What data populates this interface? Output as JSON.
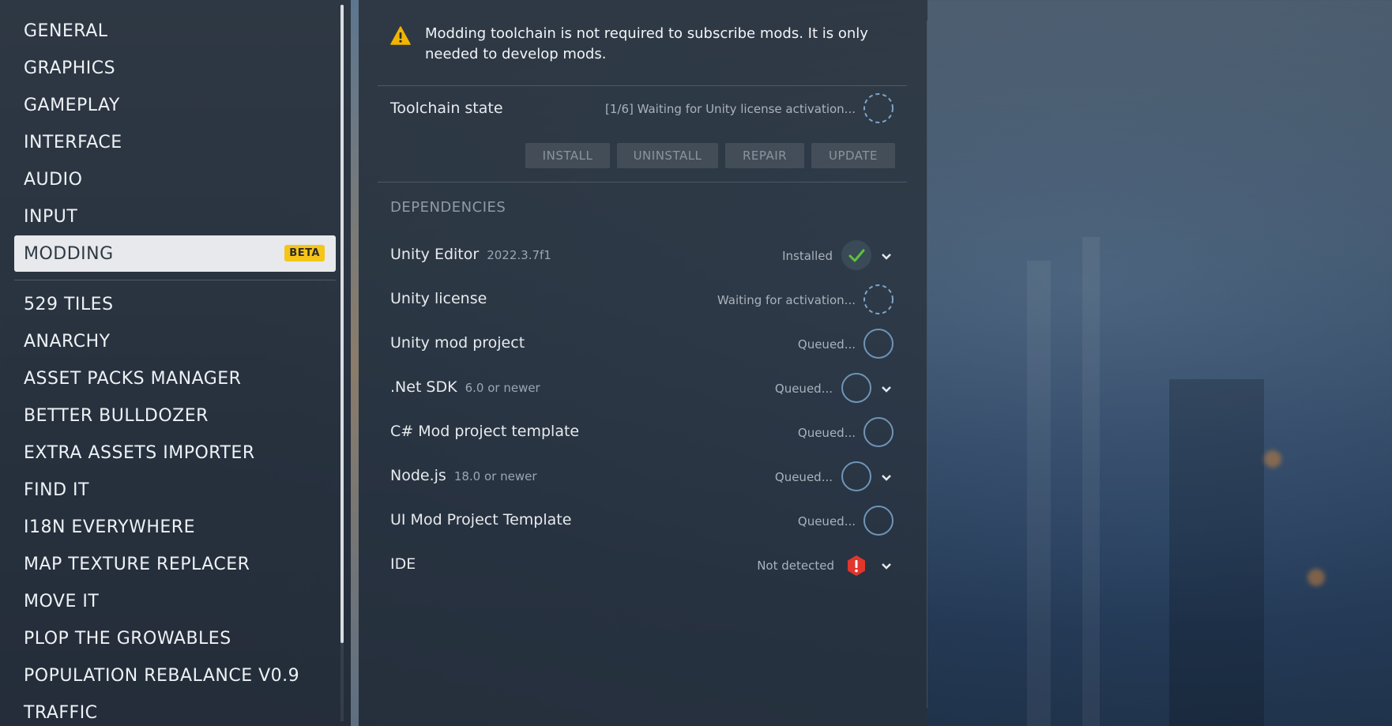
{
  "sidebar": {
    "items": [
      {
        "label": "GENERAL"
      },
      {
        "label": "GRAPHICS"
      },
      {
        "label": "GAMEPLAY"
      },
      {
        "label": "INTERFACE"
      },
      {
        "label": "AUDIO"
      },
      {
        "label": "INPUT"
      },
      {
        "label": "MODDING",
        "badge": "BETA",
        "active": true
      },
      {
        "label": "529 TILES"
      },
      {
        "label": "ANARCHY"
      },
      {
        "label": "ASSET PACKS MANAGER"
      },
      {
        "label": "BETTER BULLDOZER"
      },
      {
        "label": "EXTRA ASSETS IMPORTER"
      },
      {
        "label": "FIND IT"
      },
      {
        "label": "I18N EVERYWHERE"
      },
      {
        "label": "MAP TEXTURE REPLACER"
      },
      {
        "label": "MOVE IT"
      },
      {
        "label": "PLOP THE GROWABLES"
      },
      {
        "label": "POPULATION REBALANCE V0.9"
      },
      {
        "label": "TRAFFIC"
      }
    ]
  },
  "notice": {
    "text": "Modding toolchain is not required to subscribe mods. It is only needed to develop mods."
  },
  "toolchain": {
    "label": "Toolchain state",
    "status": "[1/6] Waiting for Unity license activation...",
    "buttons": {
      "install": "INSTALL",
      "uninstall": "UNINSTALL",
      "repair": "REPAIR",
      "update": "UPDATE"
    }
  },
  "dependencies": {
    "heading": "DEPENDENCIES",
    "items": [
      {
        "name": "Unity Editor",
        "version": "2022.3.7f1",
        "status": "Installed",
        "state": "ok",
        "expandable": true
      },
      {
        "name": "Unity license",
        "version": "",
        "status": "Waiting for activation...",
        "state": "waiting",
        "expandable": false
      },
      {
        "name": "Unity mod project",
        "version": "",
        "status": "Queued...",
        "state": "queued",
        "expandable": false
      },
      {
        "name": ".Net SDK",
        "version": "6.0 or newer",
        "status": "Queued...",
        "state": "queued",
        "expandable": true
      },
      {
        "name": "C# Mod project template",
        "version": "",
        "status": "Queued...",
        "state": "queued",
        "expandable": false
      },
      {
        "name": "Node.js",
        "version": "18.0 or newer",
        "status": "Queued...",
        "state": "queued",
        "expandable": true
      },
      {
        "name": "UI Mod Project Template",
        "version": "",
        "status": "Queued...",
        "state": "queued",
        "expandable": false
      },
      {
        "name": "IDE",
        "version": "",
        "status": "Not detected",
        "state": "error",
        "expandable": true
      }
    ]
  },
  "colors": {
    "accent_badge": "#f5c518",
    "ok": "#5cc33b",
    "error": "#e0362c",
    "ring": "#6f95b8"
  }
}
